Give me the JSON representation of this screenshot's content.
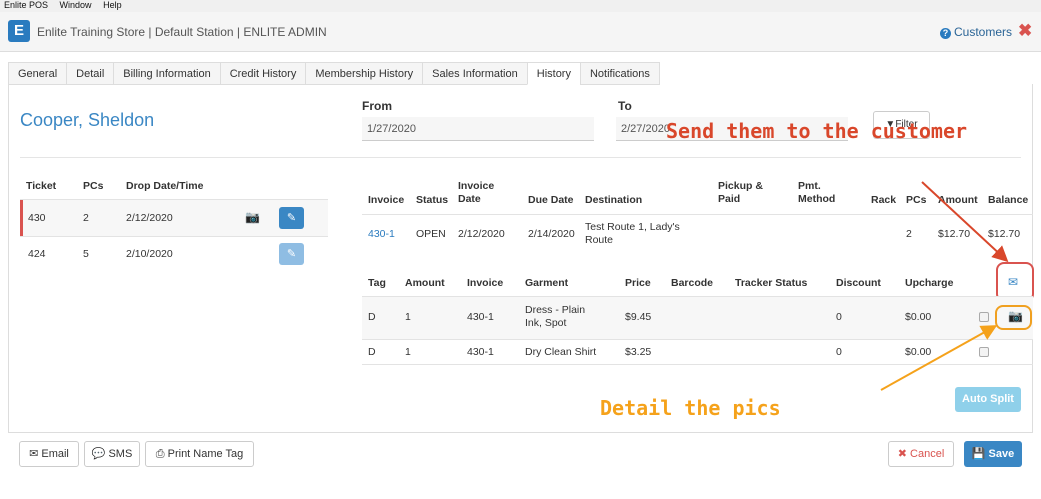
{
  "menubar": [
    "Enlite POS",
    "Window",
    "Help"
  ],
  "header": {
    "logo": "E",
    "title": "Enlite Training Store | Default Station | ENLITE ADMIN",
    "customers": "Customers",
    "close": "✖"
  },
  "tabs": [
    "General",
    "Detail",
    "Billing Information",
    "Credit History",
    "Membership History",
    "Sales Information",
    "History",
    "Notifications"
  ],
  "customer": {
    "name": "Cooper, Sheldon"
  },
  "filters": {
    "from_label": "From",
    "from_value": "1/27/2020",
    "to_label": "To",
    "to_value": "2/27/2020",
    "filter_label": "Filter"
  },
  "tickets": {
    "headers": [
      "Ticket",
      "PCs",
      "Drop Date/Time"
    ],
    "rows": [
      {
        "ticket": "430",
        "pcs": "2",
        "drop": "2/12/2020"
      },
      {
        "ticket": "424",
        "pcs": "5",
        "drop": "2/10/2020"
      }
    ]
  },
  "invoices": {
    "headers": {
      "invoice": "Invoice",
      "status": "Status",
      "invoice_date": "Invoice Date",
      "due_date": "Due Date",
      "destination": "Destination",
      "pickup": "Pickup & Paid",
      "pmt": "Pmt. Method",
      "rack": "Rack",
      "pcs": "PCs",
      "amount": "Amount",
      "balance": "Balance"
    },
    "row": {
      "invoice": "430-1",
      "status": "OPEN",
      "invoice_date": "2/12/2020",
      "due_date": "2/14/2020",
      "destination": "Test Route 1, Lady's Route",
      "pcs": "2",
      "amount": "$12.70",
      "balance": "$12.70"
    }
  },
  "garments": {
    "headers": {
      "tag": "Tag",
      "amount": "Amount",
      "invoice": "Invoice",
      "garment": "Garment",
      "price": "Price",
      "barcode": "Barcode",
      "tracker": "Tracker Status",
      "discount": "Discount",
      "upcharge": "Upcharge"
    },
    "rows": [
      {
        "tag": "D",
        "amount": "1",
        "invoice": "430-1",
        "garment": "Dress - Plain Ink, Spot",
        "price": "$9.45",
        "discount": "0",
        "upcharge": "$0.00"
      },
      {
        "tag": "D",
        "amount": "1",
        "invoice": "430-1",
        "garment": "Dry Clean Shirt",
        "price": "$3.25",
        "discount": "0",
        "upcharge": "$0.00"
      }
    ]
  },
  "auto_split": "Auto Split",
  "annotations": {
    "send": "Send them to the customer",
    "detail": "Detail the pics",
    "send_color": "#d9472b",
    "detail_color": "#f5a21b"
  },
  "footer": {
    "email": "Email",
    "sms": "SMS",
    "print": "Print Name Tag",
    "cancel": "Cancel",
    "save": "Save"
  }
}
